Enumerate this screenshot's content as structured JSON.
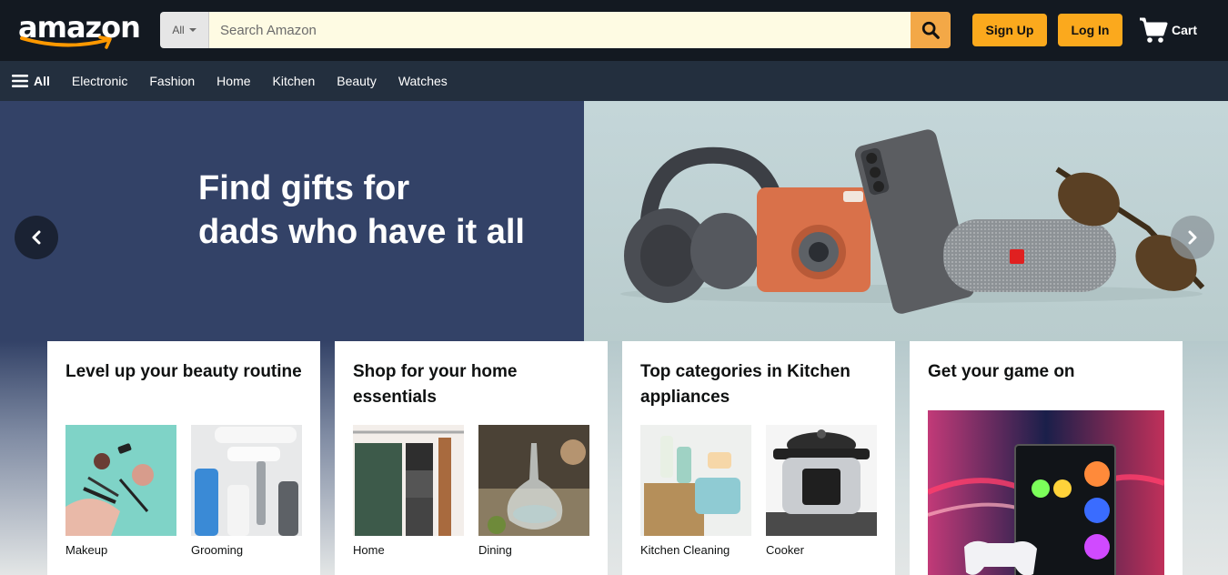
{
  "header": {
    "logo": "amazon",
    "search": {
      "category": "All",
      "placeholder": "Search Amazon"
    },
    "signup_label": "Sign Up",
    "login_label": "Log In",
    "cart_label": "Cart"
  },
  "nav": {
    "all_label": "All",
    "items": [
      "Electronic",
      "Fashion",
      "Home",
      "Kitchen",
      "Beauty",
      "Watches"
    ]
  },
  "hero": {
    "title_line1": "Find gifts for",
    "title_line2": "dads who have it all"
  },
  "cards": [
    {
      "title": "Level up your beauty routine",
      "tiles": [
        "Makeup",
        "Grooming"
      ]
    },
    {
      "title": "Shop for your home essentials",
      "tiles": [
        "Home",
        "Dining"
      ]
    },
    {
      "title": "Top categories in Kitchen appliances",
      "tiles": [
        "Kitchen Cleaning",
        "Cooker"
      ]
    },
    {
      "title": "Get your game on"
    }
  ],
  "colors": {
    "header_bg": "#131921",
    "nav_bg": "#232f3e",
    "accent": "#fba91d",
    "hero_bg": "#334267"
  },
  "icons": [
    "menu-icon",
    "search-icon",
    "cart-icon",
    "chevron-left-icon",
    "chevron-right-icon"
  ]
}
